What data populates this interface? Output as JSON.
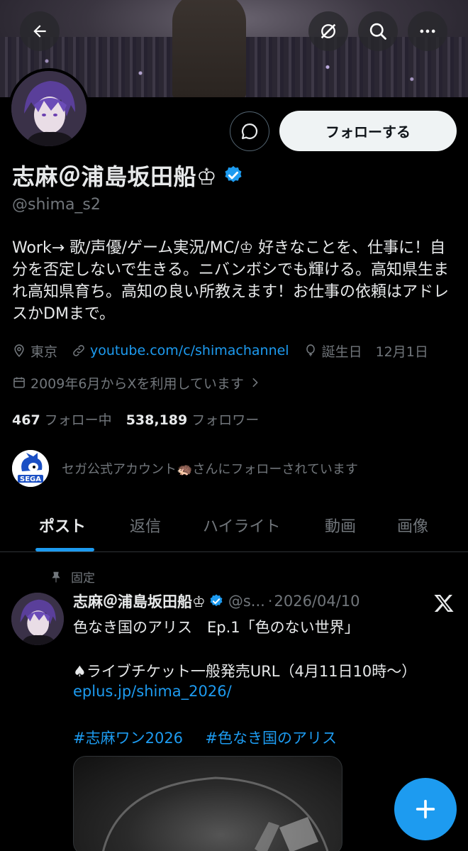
{
  "profile": {
    "display_name": "志麻＠浦島坂田船♔",
    "handle": "@shima_s2",
    "bio": "Work→ 歌/声優/ゲーム実況/MC/♔ 好きなことを、仕事に！自分を否定しないで生きる。ニバンボシでも輝ける。高知県生まれ高知県育ち。高知の良い所教えます！お仕事の依頼はアドレスかDMまで。",
    "location": "東京",
    "website": "youtube.com/c/shimachannel",
    "birthday": "誕生日　12月1日",
    "joined": "2009年6月からXを利用しています",
    "following_count": "467",
    "following_label": "フォロー中",
    "followers_count": "538,189",
    "followers_label": "フォロワー",
    "followed_by": "セガ公式アカウント🦔さんにフォローされています",
    "verified_color": "#1d9bf0"
  },
  "actions": {
    "follow_label": "フォローする"
  },
  "top_icons": {
    "back": "back-arrow-icon",
    "grok": "grok-icon",
    "search": "search-icon",
    "more": "more-icon"
  },
  "tabs": [
    {
      "label": "ポスト"
    },
    {
      "label": "返信"
    },
    {
      "label": "ハイライト"
    },
    {
      "label": "動画"
    },
    {
      "label": "画像"
    }
  ],
  "pinned_post": {
    "pinned_label": "固定",
    "author_name": "志麻＠浦島坂田船♔",
    "author_handle": "@s...",
    "date": "2026/04/10",
    "line1": "色なき国のアリス　Ep.1「色のない世界」",
    "line2": "♠ライブチケット一般発売URL（4月11日10時〜）",
    "link": "eplus.jp/shima_2026/",
    "hashtag1": "#志麻ワン2026",
    "hashtag2": "#色なき国のアリス"
  },
  "colors": {
    "accent": "#1d9bf0",
    "background": "#000000",
    "muted_text": "#71767b"
  }
}
